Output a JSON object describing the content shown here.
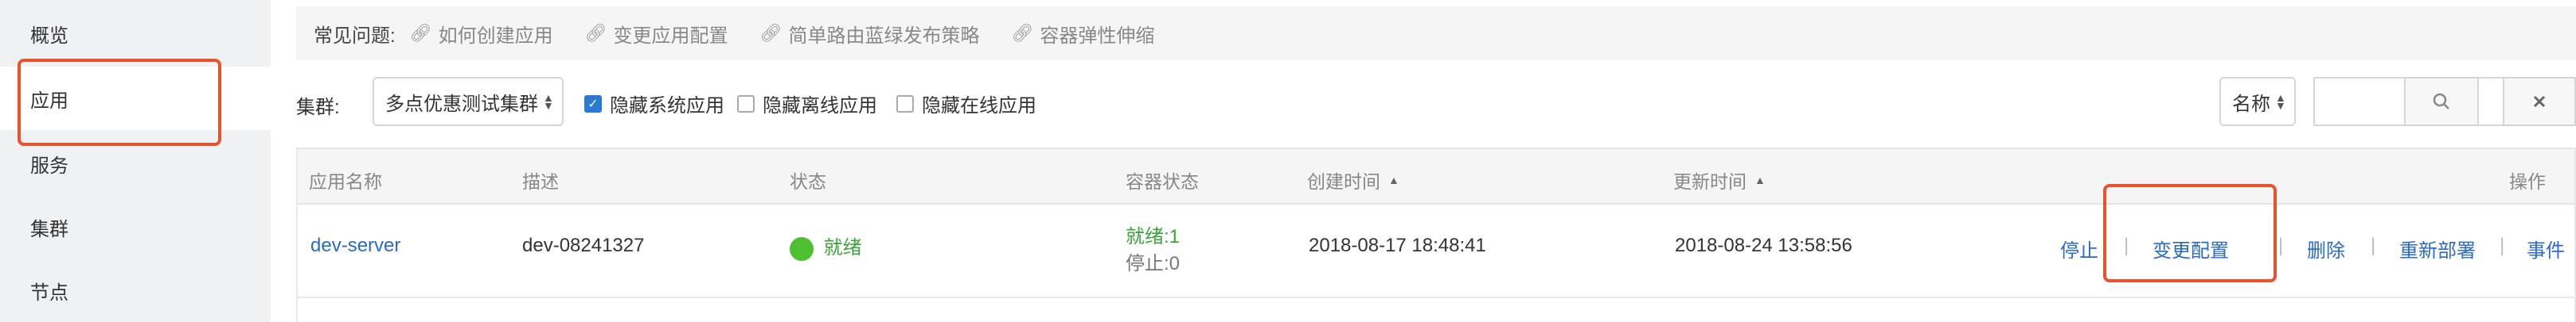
{
  "sidebar": {
    "items": [
      {
        "label": "概览"
      },
      {
        "label": "应用"
      },
      {
        "label": "服务"
      },
      {
        "label": "集群"
      },
      {
        "label": "节点"
      }
    ],
    "highlight_color": "#e8522c"
  },
  "faq": {
    "label": "常见问题:",
    "links": [
      "如何创建应用",
      "变更应用配置",
      "简单路由蓝绿发布策略",
      "容器弹性伸缩"
    ]
  },
  "toolbar": {
    "cluster_label": "集群:",
    "cluster_value": "多点优惠测试集群",
    "hide_system": "隐藏系统应用",
    "hide_offline": "隐藏离线应用",
    "hide_online": "隐藏在线应用",
    "hide_system_checked": true,
    "hide_offline_checked": false,
    "hide_online_checked": false,
    "search_field": "名称",
    "search_value": ""
  },
  "table": {
    "headers": {
      "name": "应用名称",
      "desc": "描述",
      "status": "状态",
      "container_status": "容器状态",
      "created": "创建时间",
      "updated": "更新时间",
      "actions": "操作"
    },
    "rows": [
      {
        "name": "dev-server",
        "desc": "dev-08241327",
        "status": "就绪",
        "container_ready": "就绪:1",
        "container_stopped": "停止:0",
        "created": "2018-08-17 18:48:41",
        "updated": "2018-08-24 13:58:56",
        "actions": [
          "停止",
          "变更配置",
          "删除",
          "重新部署",
          "事件"
        ]
      }
    ]
  },
  "colors": {
    "link": "#2a6ac8",
    "ready_green": "#3aa33a",
    "checkbox_blue": "#2a7ad4"
  }
}
